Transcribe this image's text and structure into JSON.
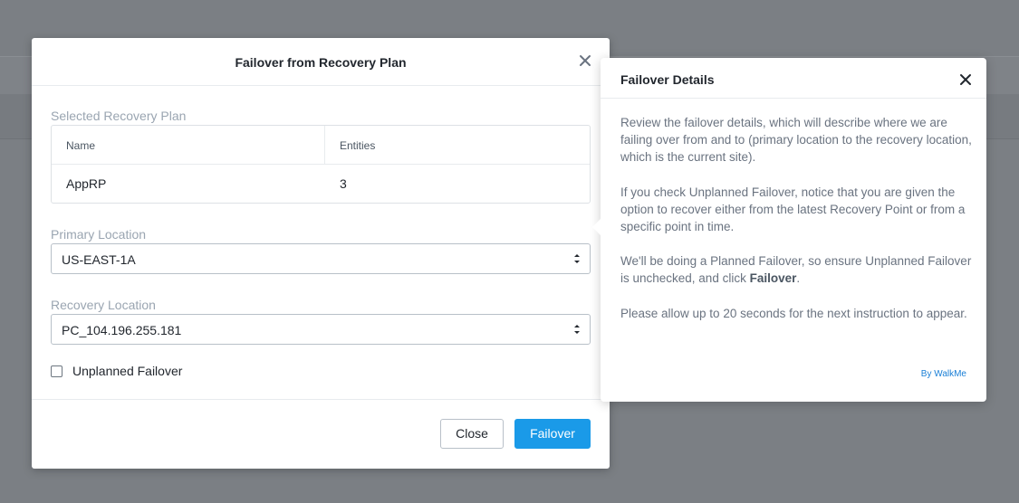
{
  "modal": {
    "title": "Failover from Recovery Plan",
    "selected_plan_label": "Selected Recovery Plan",
    "table": {
      "columns": [
        "Name",
        "Entities"
      ],
      "rows": [
        [
          "AppRP",
          "3"
        ]
      ]
    },
    "primary_location_label": "Primary Location",
    "primary_location_value": "US-EAST-1A",
    "recovery_location_label": "Recovery Location",
    "recovery_location_value": "PC_104.196.255.181",
    "unplanned_failover_label": "Unplanned Failover",
    "unplanned_failover_checked": false,
    "close_button": "Close",
    "failover_button": "Failover"
  },
  "popover": {
    "title": "Failover Details",
    "paragraph1": "Review the failover details, which will describe where we are failing over from and to (primary location to the recovery location, which is the current site).",
    "paragraph2": "If you check Unplanned Failover, notice that you are given the option to recover either from the latest Recovery Point or from a specific point in time.",
    "paragraph3_pre": "We'll be doing a Planned Failover, so ensure Unplanned Failover is unchecked, and click ",
    "paragraph3_bold": "Failover",
    "paragraph3_post": ".",
    "paragraph4": "Please allow up to 20 seconds for the next instruction to appear.",
    "footer_link": "By WalkMe"
  },
  "colors": {
    "primary_button": "#1a9ae8",
    "overlay": "#7b7f84"
  }
}
